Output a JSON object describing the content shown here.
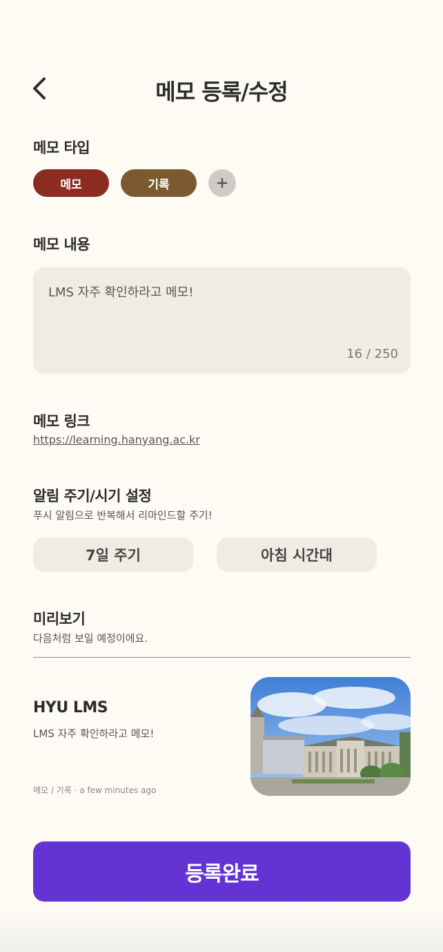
{
  "header": {
    "title": "메모 등록/수정",
    "back_icon": "chevron-left-icon"
  },
  "memo_type": {
    "title": "메모 타입",
    "chips": [
      {
        "label": "메모",
        "color": "#8b2b22"
      },
      {
        "label": "기록",
        "color": "#7a5a2e"
      }
    ],
    "add_icon": "plus-icon"
  },
  "memo_content": {
    "title": "메모 내용",
    "text": "LMS 자주 확인하라고 메모!",
    "counter": "16 / 250"
  },
  "memo_link": {
    "title": "메모 링크",
    "url": "https://learning.hanyang.ac.kr"
  },
  "notification": {
    "title": "알림 주기/시기 설정",
    "subtitle": "푸시 알림으로 반복해서 리마인드할 주기!",
    "period": "7일 주기",
    "time": "아침 시간대"
  },
  "preview": {
    "title": "미리보기",
    "subtitle": "다음처럼 보일 예정이에요.",
    "card_title": "HYU LMS",
    "card_body": "LMS 자주 확인하라고 메모!",
    "card_meta": "메모 / 기록 · a few minutes ago"
  },
  "submit": {
    "label": "등록완료",
    "color": "#6333d4"
  }
}
